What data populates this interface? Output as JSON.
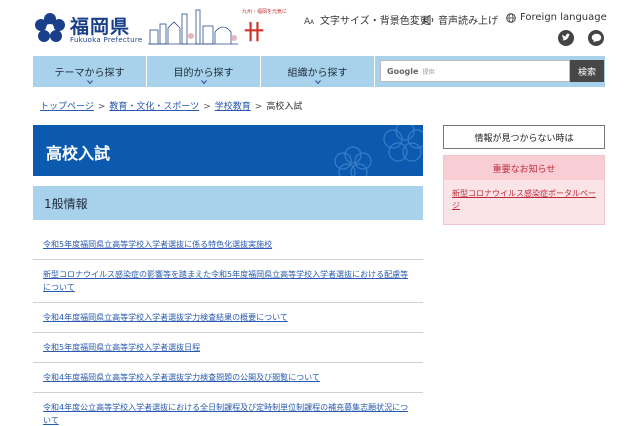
{
  "header": {
    "logo_text": "福岡県",
    "logo_sub": "Fukuoka Prefecture",
    "brand_top": "九州・福岡を元気に",
    "brand_mark": "卄",
    "util": {
      "text_size": "文字サイズ・背景色変更",
      "read_aloud": "音声読み上げ",
      "language": "Foreign language"
    },
    "sns": [
      "twitter",
      "line"
    ]
  },
  "nav": {
    "items": [
      {
        "label": "テーマから探す"
      },
      {
        "label": "目的から探す"
      },
      {
        "label": "組織から探す"
      }
    ],
    "search": {
      "brand": "Google",
      "placeholder": "提供",
      "button": "検索"
    }
  },
  "breadcrumb": [
    {
      "label": "トップページ",
      "link": true
    },
    {
      "label": "教育・文化・スポーツ",
      "link": true
    },
    {
      "label": "学校教育",
      "link": true
    },
    {
      "label": "高校入試",
      "link": false
    }
  ],
  "page": {
    "title": "高校入試",
    "section": "1般情報",
    "items": [
      {
        "text": "令和5年度福岡県立高等学校入学者選抜に係る特色化選抜実施校"
      },
      {
        "text": "新型コロナウイルス感染症の影響等を踏まえた令和5年度福岡県立高等学校入学者選抜における配慮等について"
      },
      {
        "text": "令和4年度福岡県立高等学校入学者選抜学力検査結果の概要について"
      },
      {
        "text": "令和5年度福岡県立高等学校入学者選抜日程"
      },
      {
        "text": "令和4年度福岡県立高等学校入学者選抜学力検査問題の公開及び閲覧について"
      },
      {
        "text": "令和4年度公立高等学校入学者選抜における全日制課程及び定時制単位制課程の補充募集志願状況について"
      }
    ]
  },
  "sidebar": {
    "help": "情報が見つからない時は",
    "notice_title": "重要なお知らせ",
    "notice_link": "新型コロナウイルス感染症ポータルページ"
  },
  "colors": {
    "title_bg": "#0b5ab0",
    "nav_bg": "#a8d2ec",
    "link": "#2a5bb0",
    "notice_text": "#c02a38"
  }
}
